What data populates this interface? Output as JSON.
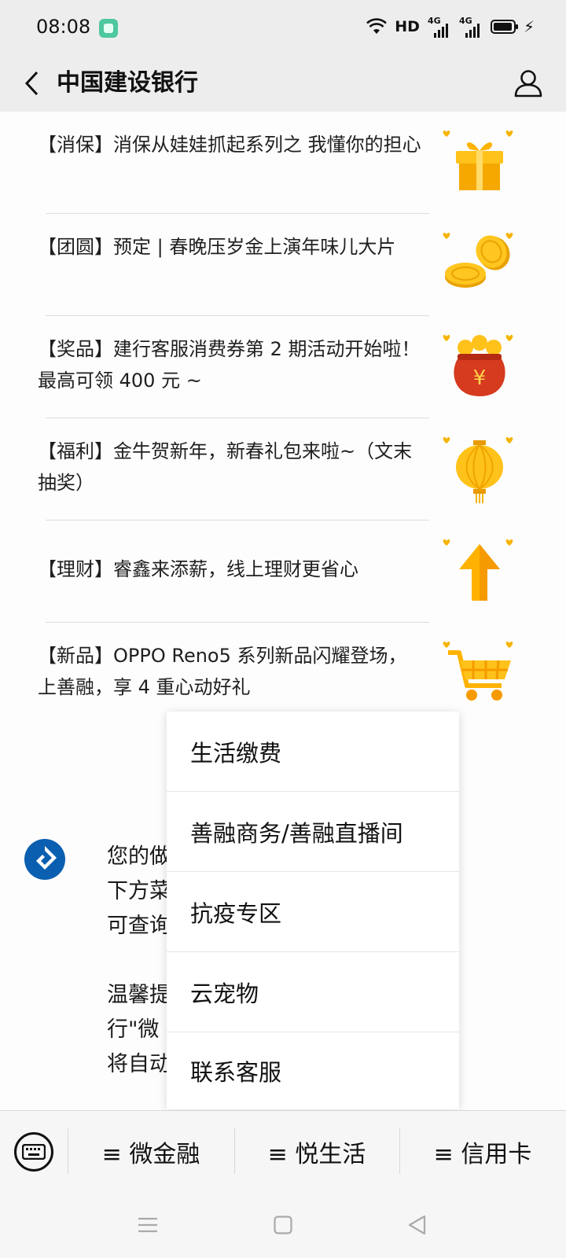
{
  "status_bar": {
    "time": "08:08",
    "hd_label": "HD",
    "network_1": "4G",
    "network_2": "4G"
  },
  "header": {
    "title": "中国建设银行",
    "back_icon": "chevron-left-icon",
    "profile_icon": "person-icon"
  },
  "articles": [
    {
      "title": "【消保】消保从娃娃抓起系列之 我懂你的担心",
      "thumb": "gift-box-icon"
    },
    {
      "title": "【团圆】预定 | 春晚压岁金上演年味儿大片",
      "thumb": "gold-coins-icon"
    },
    {
      "title": "【奖品】建行客服消费券第 2 期活动开始啦！最高可领 400 元 ~",
      "thumb": "money-bag-icon"
    },
    {
      "title": "【福利】金牛贺新年，新春礼包来啦~（文末抽奖）",
      "thumb": "lantern-icon"
    },
    {
      "title": "【理财】睿鑫来添薪，线上理财更省心",
      "thumb": "up-arrow-icon"
    },
    {
      "title": "【新品】OPPO Reno5 系列新品闪耀登场，上善融，享 4 重心动好礼",
      "thumb": "shopping-cart-icon"
    }
  ],
  "message": {
    "text": "您的做\n下方菜\n可查询\n\n温馨提\n行\"微\n将自动"
  },
  "popup_menu": {
    "items": [
      "生活缴费",
      "善融商务/善融直播间",
      "抗疫专区",
      "云宠物",
      "联系客服"
    ]
  },
  "menu_bar": {
    "items": [
      "≡ 微金融",
      "≡ 悦生活",
      "≡ 信用卡"
    ]
  },
  "colors": {
    "accent_gold": "#f5b400",
    "bank_blue": "#0b5fb0",
    "bag_red": "#d63a1f"
  }
}
